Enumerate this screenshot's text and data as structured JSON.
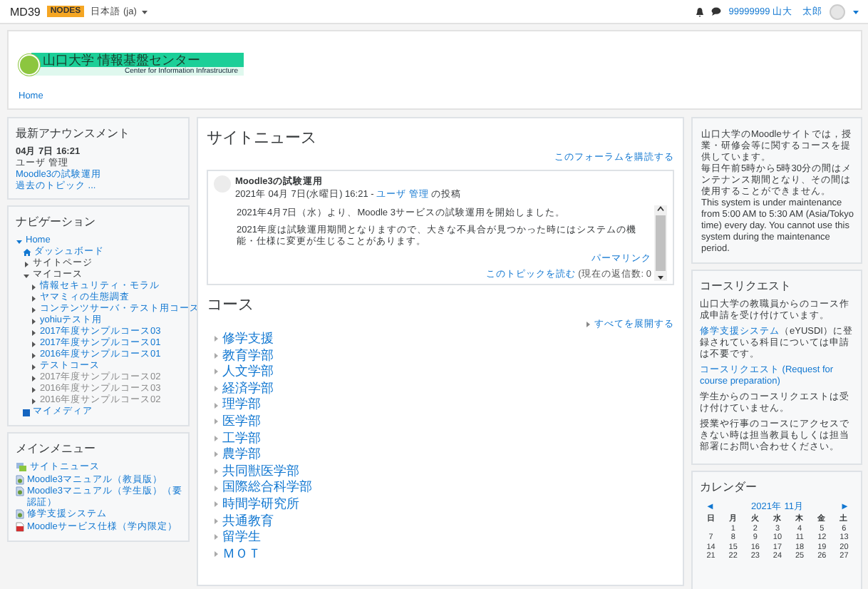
{
  "top_bar": {
    "site_name": "MD39",
    "badge": "NODES",
    "language": "日本語 (ja)",
    "user_name": "99999999 山大　太郎"
  },
  "header": {
    "logo_title": "山口大学 情報基盤センター",
    "logo_subtitle": "Center for Information Infrastructure",
    "breadcrumb": "Home"
  },
  "announcements": {
    "title": "最新アナウンスメント",
    "date": "04月 7日 16:21",
    "author": "ユーザ 管理",
    "post_link": "Moodle3の試験運用",
    "older_link": "過去のトピック ..."
  },
  "navigation": {
    "title": "ナビゲーション",
    "items": [
      {
        "label": "Home",
        "kind": "branch",
        "expanded": true,
        "dimmed": false,
        "children": [
          {
            "label": "ダッシュボード",
            "kind": "dashboard",
            "dimmed": false
          },
          {
            "label": "サイトページ",
            "kind": "branch",
            "expanded": false,
            "dimmed": false
          },
          {
            "label": "マイコース",
            "kind": "branch",
            "expanded": true,
            "dimmed": false,
            "children": [
              {
                "label": "情報セキュリティ・モラル",
                "kind": "branch",
                "expanded": false,
                "dimmed": false
              },
              {
                "label": "ヤマミィの生態調査",
                "kind": "branch",
                "expanded": false,
                "dimmed": false
              },
              {
                "label": "コンテンツサーバ・テスト用コース",
                "kind": "branch",
                "expanded": false,
                "dimmed": false
              },
              {
                "label": "yohiuテスト用",
                "kind": "branch",
                "expanded": false,
                "dimmed": false
              },
              {
                "label": "2017年度サンプルコース03",
                "kind": "branch",
                "expanded": false,
                "dimmed": false
              },
              {
                "label": "2017年度サンプルコース01",
                "kind": "branch",
                "expanded": false,
                "dimmed": false
              },
              {
                "label": "2016年度サンプルコース01",
                "kind": "branch",
                "expanded": false,
                "dimmed": false
              },
              {
                "label": "テストコース",
                "kind": "branch",
                "expanded": false,
                "dimmed": false
              },
              {
                "label": "2017年度サンプルコース02",
                "kind": "branch",
                "expanded": false,
                "dimmed": true
              },
              {
                "label": "2016年度サンプルコース03",
                "kind": "branch",
                "expanded": false,
                "dimmed": true
              },
              {
                "label": "2016年度サンプルコース02",
                "kind": "branch",
                "expanded": false,
                "dimmed": true
              }
            ]
          },
          {
            "label": "マイメディア",
            "kind": "media",
            "dimmed": false
          }
        ]
      }
    ]
  },
  "main_menu": {
    "title": "メインメニュー",
    "items": [
      {
        "label": "サイトニュース",
        "kind": "forum"
      },
      {
        "label": "Moodle3マニュアル（教員版）",
        "kind": "page"
      },
      {
        "label": "Moodle3マニュアル（学生版）（要認証）",
        "kind": "page"
      },
      {
        "label": "修学支援システム",
        "kind": "page"
      },
      {
        "label": "Moodleサービス仕様（学内限定）",
        "kind": "pdf"
      }
    ]
  },
  "site_news": {
    "title": "サイトニュース",
    "subscribe_link": "このフォーラムを購読する",
    "post": {
      "subject": "Moodle3の試験運用",
      "byline_date": "2021年 04月 7日(水曜日) 16:21 -",
      "author": "ユーザ 管理",
      "byline_suffix": "の投稿",
      "paragraphs": [
        "2021年4月7日（水）より、Moodle 3サービスの試験運用を開始しました。",
        "2021年度は試験運用期間となりますので、大きな不具合が見つかった時にはシステムの機能・仕様に変更が生じることがあります。"
      ],
      "permalink": "パーマリンク",
      "read_link": "このトピックを読む",
      "replies": "(現在の返信数: 0"
    }
  },
  "courses": {
    "title": "コース",
    "expand_all": "すべてを展開する",
    "categories": [
      "修学支援",
      "教育学部",
      "人文学部",
      "経済学部",
      "理学部",
      "医学部",
      "工学部",
      "農学部",
      "共同獣医学部",
      "国際総合科学部",
      "時間学研究所",
      "共通教育",
      "留学生",
      "ＭＯＴ"
    ]
  },
  "info_block": {
    "paragraphs": [
      "山口大学のMoodleサイトでは，授業・研修会等に関するコースを提供しています。",
      "毎日午前5時から5時30分の間はメンテナンス期間となり、その間は使用することができません。",
      "This system is under maintenance from 5:00 AM to 5:30 AM (Asia/Tokyo time) every day. You cannot use this system during the maintenance period."
    ]
  },
  "course_request": {
    "title": "コースリクエスト",
    "paragraphs": [
      {
        "kind": "text",
        "text": "山口大学の教職員からのコース作成申請を受け付けています。"
      },
      {
        "kind": "link_text",
        "link": "修学支援システム",
        "text": "（eYUSDI）に登録されている科目については申請は不要です。"
      },
      {
        "kind": "link",
        "link": "コースリクエスト (Request for course preparation)"
      },
      {
        "kind": "text",
        "text": "学生からのコースリクエストは受け付けていません。"
      },
      {
        "kind": "text",
        "text": "授業や行事のコースにアクセスできない時は担当教員もしくは担当部署にお問い合わせください。"
      }
    ]
  },
  "calendar": {
    "title": "カレンダー",
    "prev": "◄",
    "month": "2021年 11月",
    "next": "►",
    "weekdays": [
      "日",
      "月",
      "火",
      "水",
      "木",
      "金",
      "土"
    ],
    "weeks": [
      {
        "kind": "partial_start",
        "days": [
          "1",
          "2",
          "3",
          "4",
          "5",
          "6"
        ]
      },
      {
        "kind": "full",
        "days": [
          "7",
          "8",
          "9",
          "10",
          "11",
          "12",
          "13"
        ]
      },
      {
        "kind": "full",
        "days": [
          "14",
          "15",
          "16",
          "17",
          "18",
          "19",
          "20"
        ]
      },
      {
        "kind": "full",
        "days": [
          "21",
          "22",
          "23",
          "24",
          "25",
          "26",
          "27"
        ]
      }
    ]
  }
}
